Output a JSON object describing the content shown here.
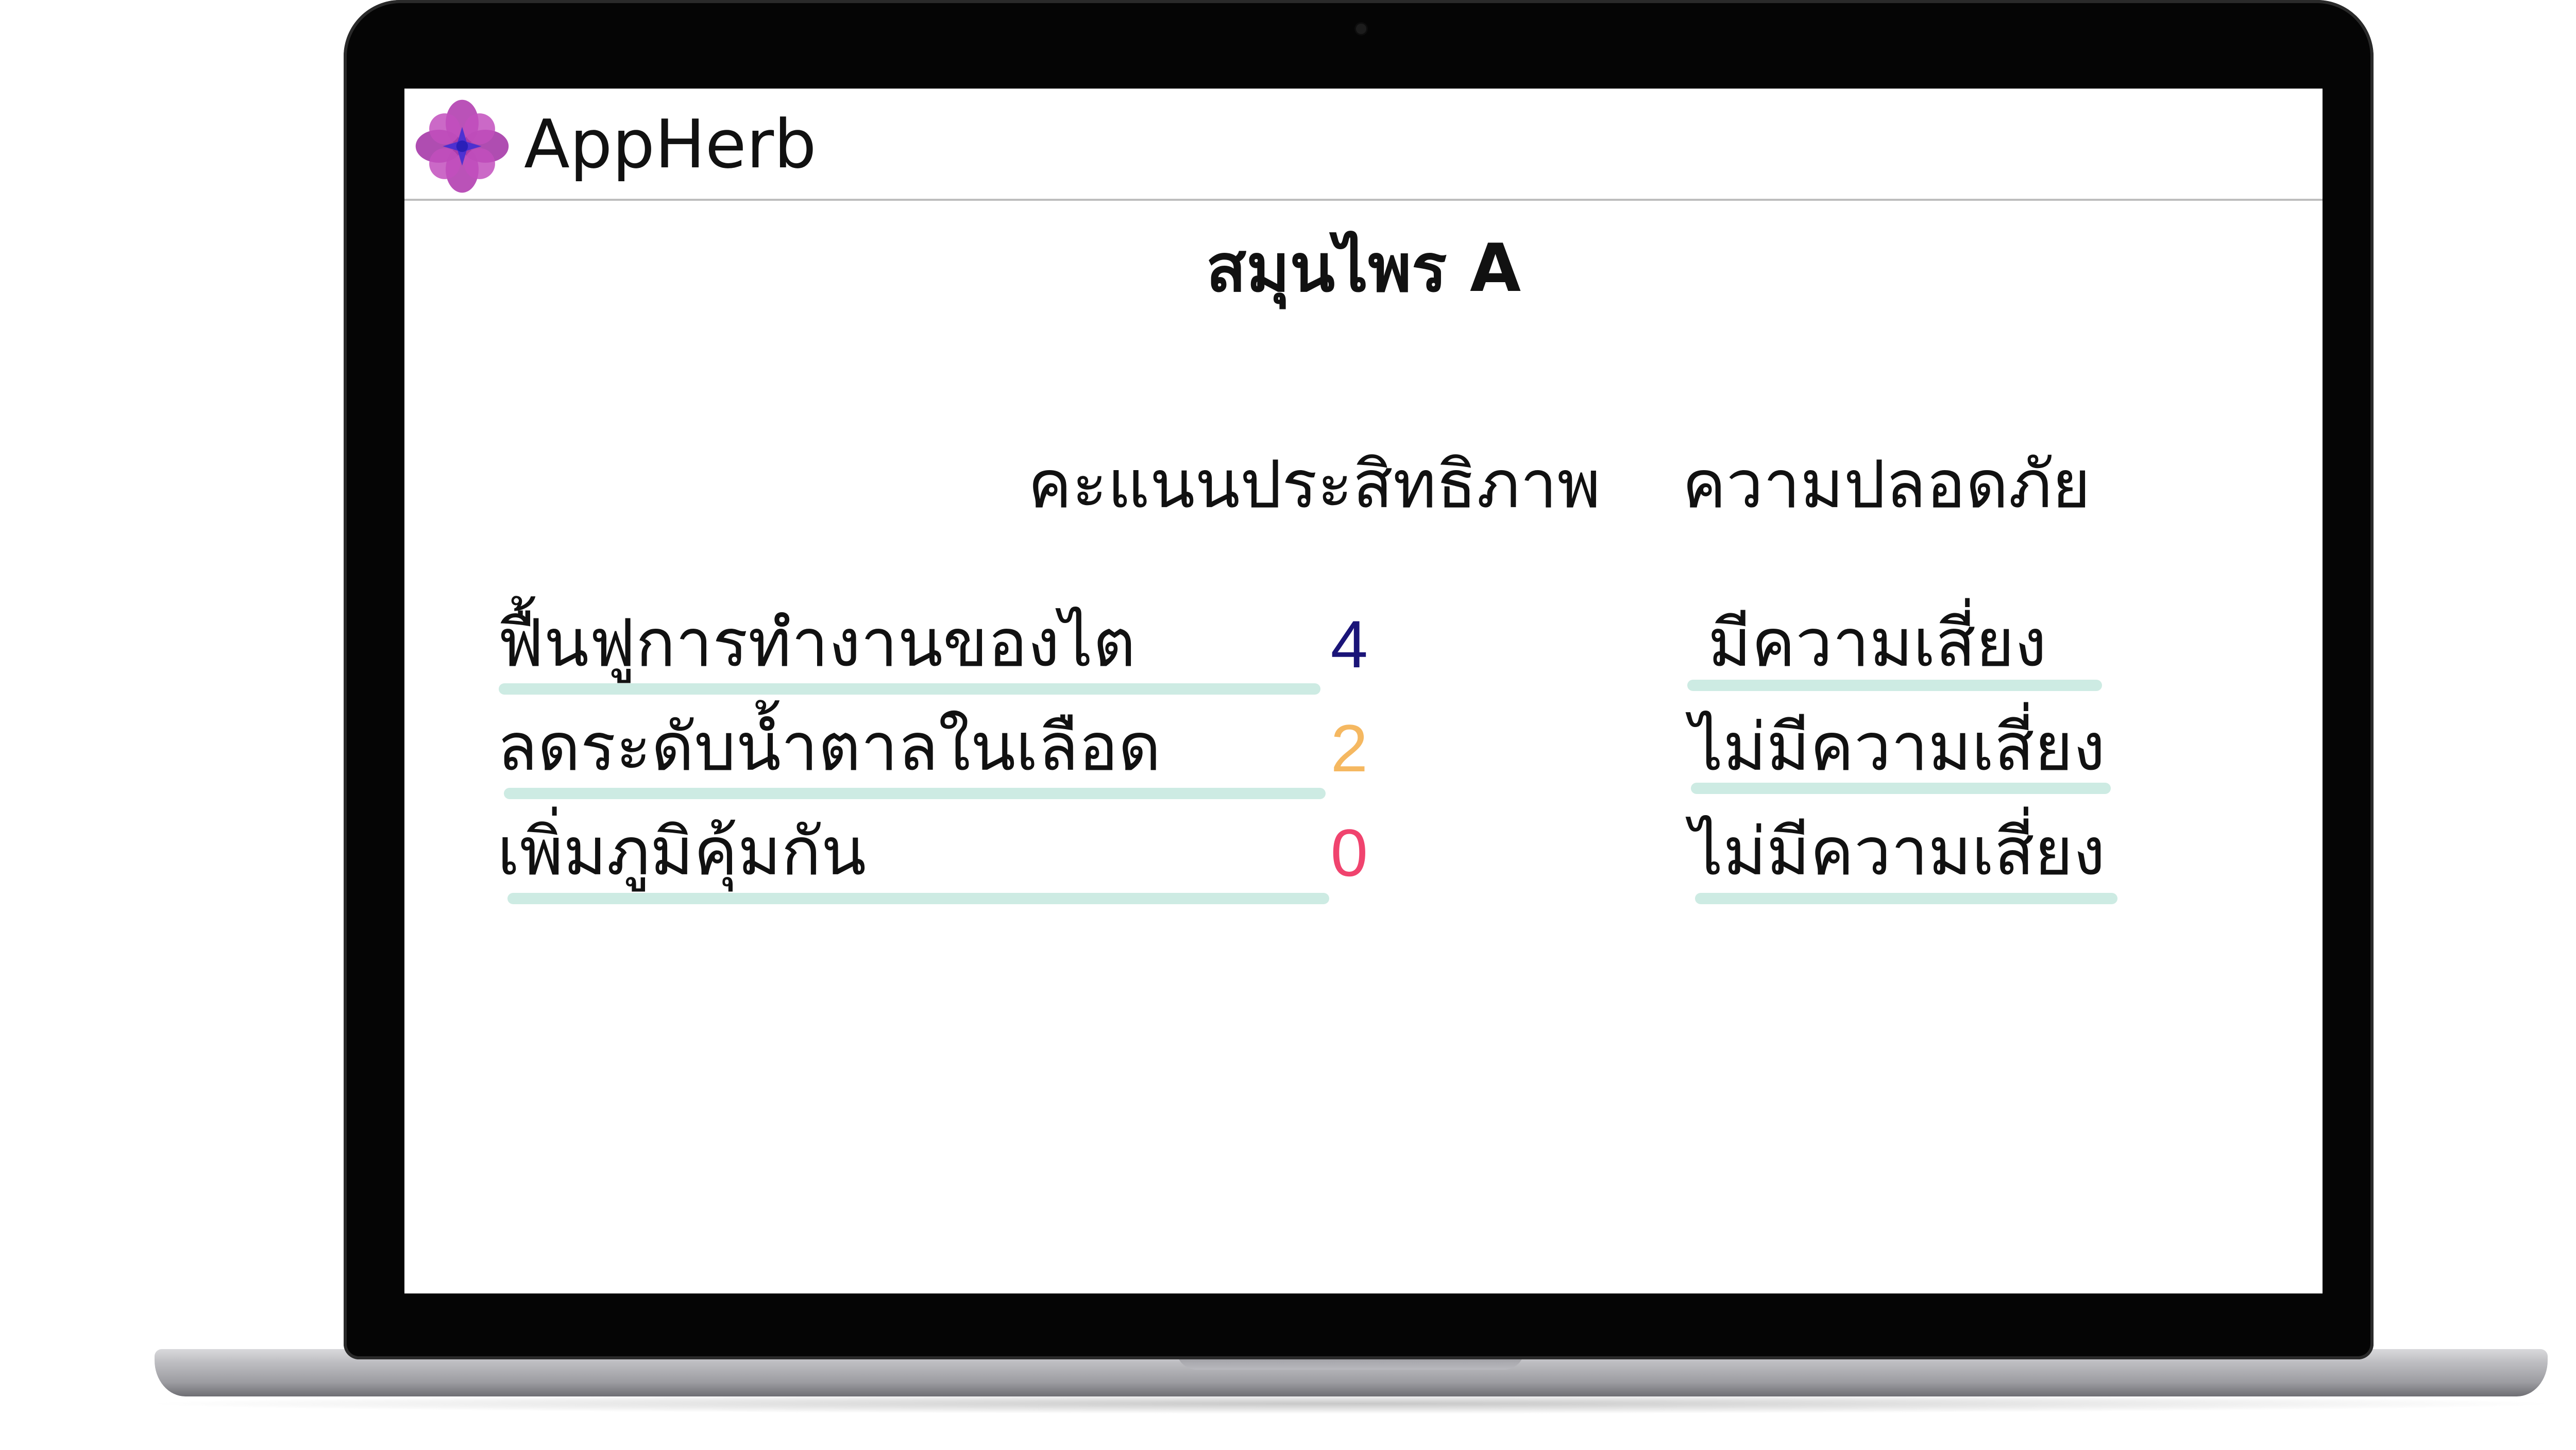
{
  "app": {
    "name": "AppHerb",
    "logo_icon": "flower-logo-icon"
  },
  "page": {
    "title": "สมุนไพร A"
  },
  "table": {
    "headers": {
      "efficacy": "คะแนนประสิทธิภาพ",
      "safety": "ความปลอดภัย"
    },
    "rows": [
      {
        "label": "ฟื้นฟูการทำงานของไต",
        "score": "4",
        "score_color": "#1a1478",
        "safety": "มีความเสี่ยง"
      },
      {
        "label": "ลดระดับน้ำตาลในเลือด",
        "score": "2",
        "score_color": "#f5b861",
        "safety": "ไม่มีความเสี่ยง"
      },
      {
        "label": "เพิ่มภูมิคุ้มกัน",
        "score": "0",
        "score_color": "#f0436e",
        "safety": "ไม่มีความเสี่ยง"
      }
    ]
  },
  "colors": {
    "underline": "#cdebe3",
    "logo_petals": "#b33fb0",
    "logo_center": "#3b2bd6"
  }
}
